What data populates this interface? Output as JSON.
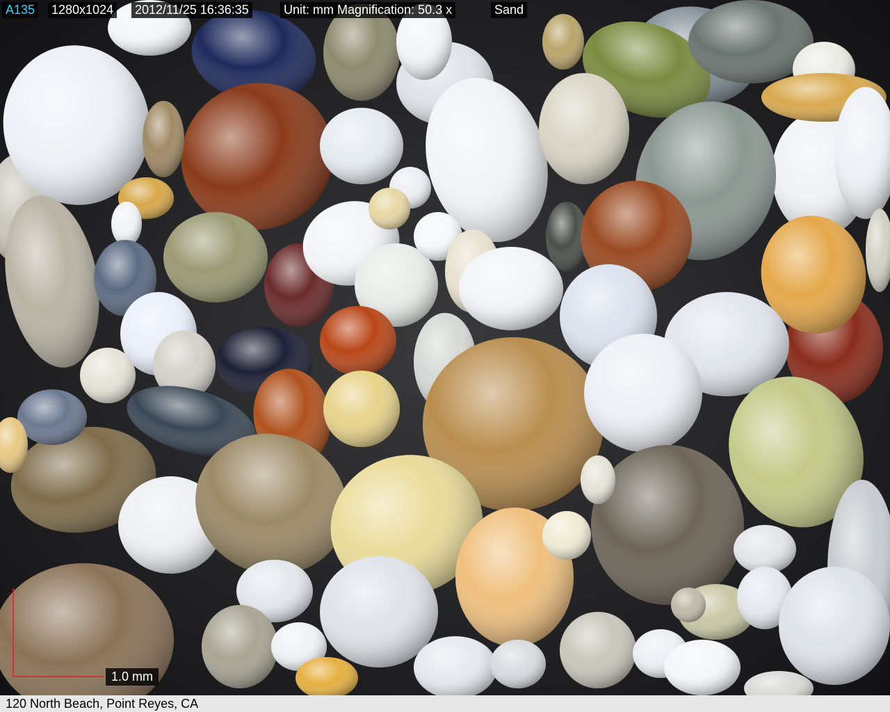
{
  "overlay": {
    "image_id": "A135",
    "resolution": "1280x1024",
    "datetime": "2012/11/25 16:36:35",
    "unit_magnification": "Unit: mm  Magnification:  50.3 x",
    "material": "Sand"
  },
  "scale_bar": {
    "label": "1.0 mm",
    "color": "#e0202a"
  },
  "caption": "120 North Beach, Point Reyes, CA",
  "colors": {
    "id_text": "#2bd9ff",
    "hud_bg": "#000000",
    "caption_bg": "#e8e8e8"
  }
}
